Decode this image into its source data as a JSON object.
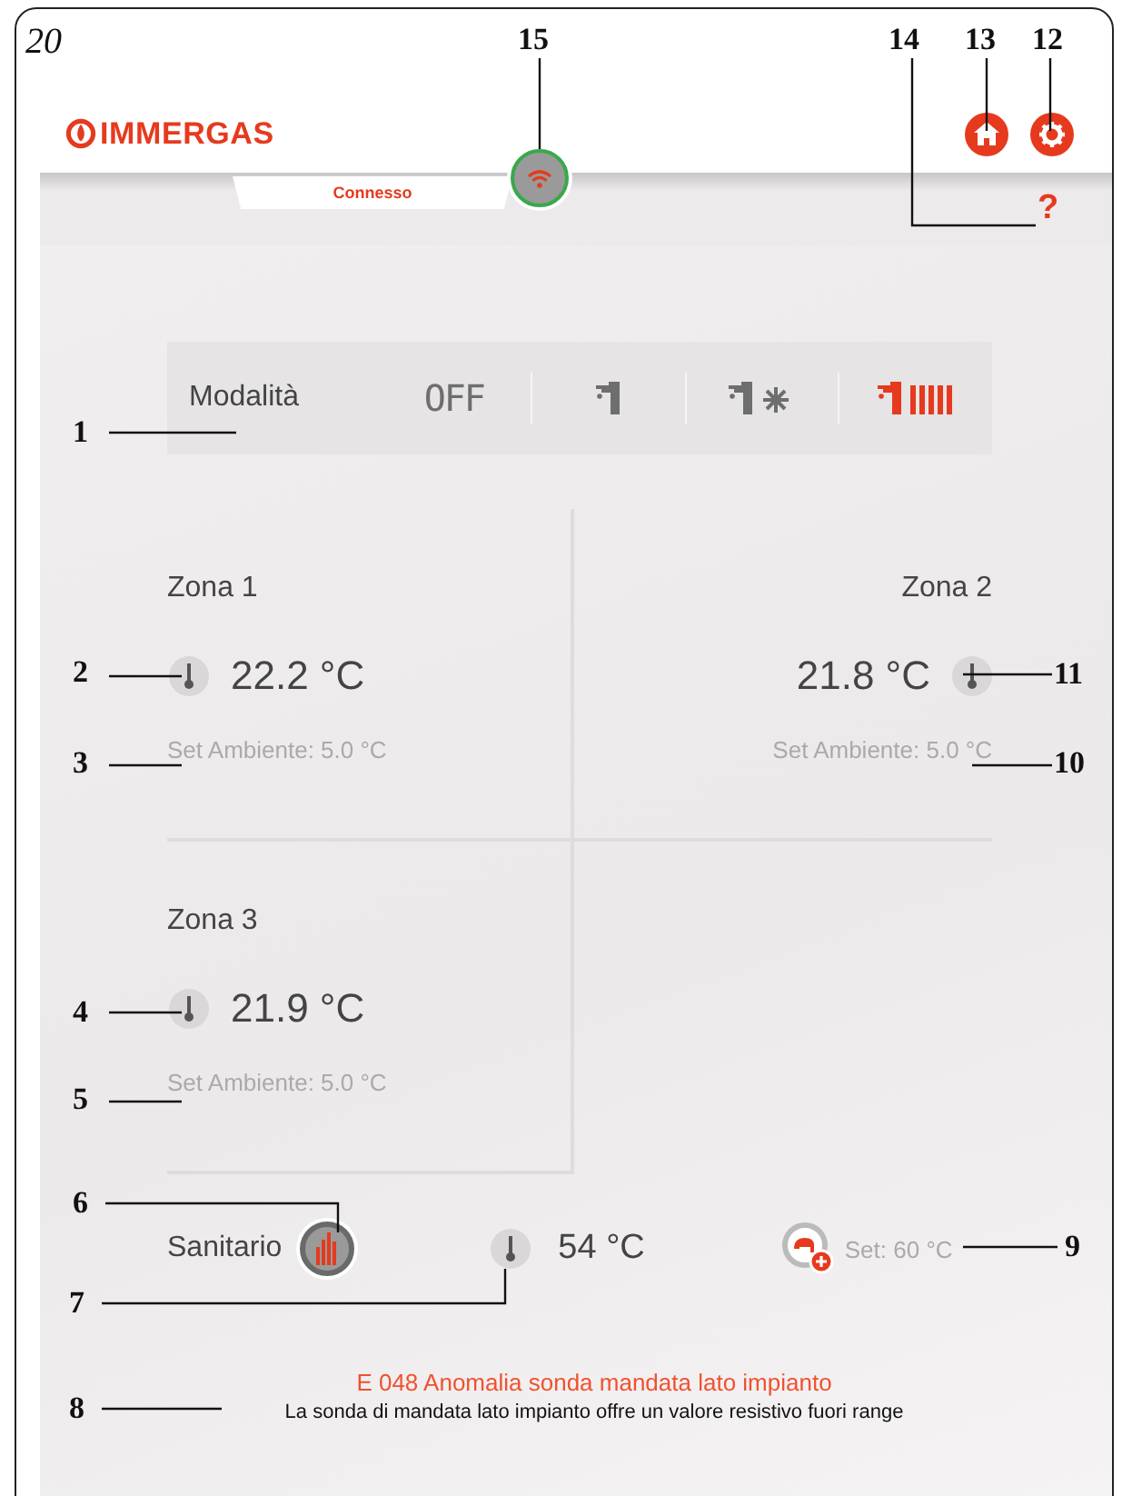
{
  "figure_number": "20",
  "header": {
    "logo": "IMMERGAS",
    "status": "Connesso",
    "connected": true,
    "help": "?"
  },
  "mode_bar": {
    "label": "Modalità",
    "modes": [
      {
        "kind": "off",
        "label": "OFF",
        "selected": false
      },
      {
        "kind": "dhw",
        "selected": false
      },
      {
        "kind": "dhw_cooling",
        "selected": false
      },
      {
        "kind": "dhw_heating",
        "selected": true
      }
    ]
  },
  "zones": [
    {
      "name": "Zona 1",
      "temperature": "22.2 °C",
      "setpoint": "Set Ambiente: 5.0 °C"
    },
    {
      "name": "Zona 2",
      "temperature": "21.8 °C",
      "setpoint": "Set Ambiente: 5.0 °C"
    },
    {
      "name": "Zona 3",
      "temperature": "21.9 °C",
      "setpoint": "Set Ambiente: 5.0 °C"
    }
  ],
  "dhw": {
    "label": "Sanitario",
    "active": true,
    "temperature": "54 °C",
    "setpoint": "Set: 60 °C"
  },
  "alarm": {
    "title": "E 048 Anomalia sonda mandata lato impianto",
    "description": "La sonda di mandata lato impianto offre un valore resistivo fuori range"
  },
  "callouts": [
    {
      "label": "15"
    },
    {
      "label": "14"
    },
    {
      "label": "13"
    },
    {
      "label": "12"
    },
    {
      "label": "1"
    },
    {
      "label": "2"
    },
    {
      "label": "11"
    },
    {
      "label": "3"
    },
    {
      "label": "10"
    },
    {
      "label": "4"
    },
    {
      "label": "5"
    },
    {
      "label": "6"
    },
    {
      "label": "9"
    },
    {
      "label": "7"
    },
    {
      "label": "8"
    }
  ]
}
